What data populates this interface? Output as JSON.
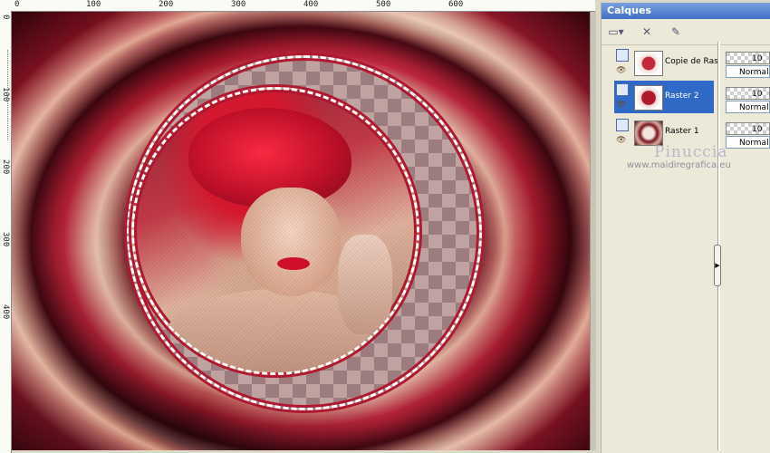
{
  "ruler": {
    "top_labels": [
      "0",
      "100",
      "200",
      "300",
      "400",
      "500",
      "600"
    ],
    "left_labels": [
      "0",
      "100",
      "200",
      "300",
      "400"
    ]
  },
  "layers_panel": {
    "title": "Calques",
    "layers": [
      {
        "name": "Copie de Ras",
        "selected": false
      },
      {
        "name": "Raster 2",
        "selected": true
      },
      {
        "name": "Raster 1",
        "selected": false
      }
    ],
    "opacity_values": [
      "10",
      "10",
      "10"
    ],
    "blend_modes": [
      "Normal",
      "Normal",
      "Normal"
    ]
  },
  "watermark": {
    "name": "Pinuccia",
    "url": "www.maidiregrafica.eu"
  },
  "colors": {
    "selection": "#3169c6",
    "title_bar": "#3f6fc5",
    "border_red": "#b01830"
  }
}
